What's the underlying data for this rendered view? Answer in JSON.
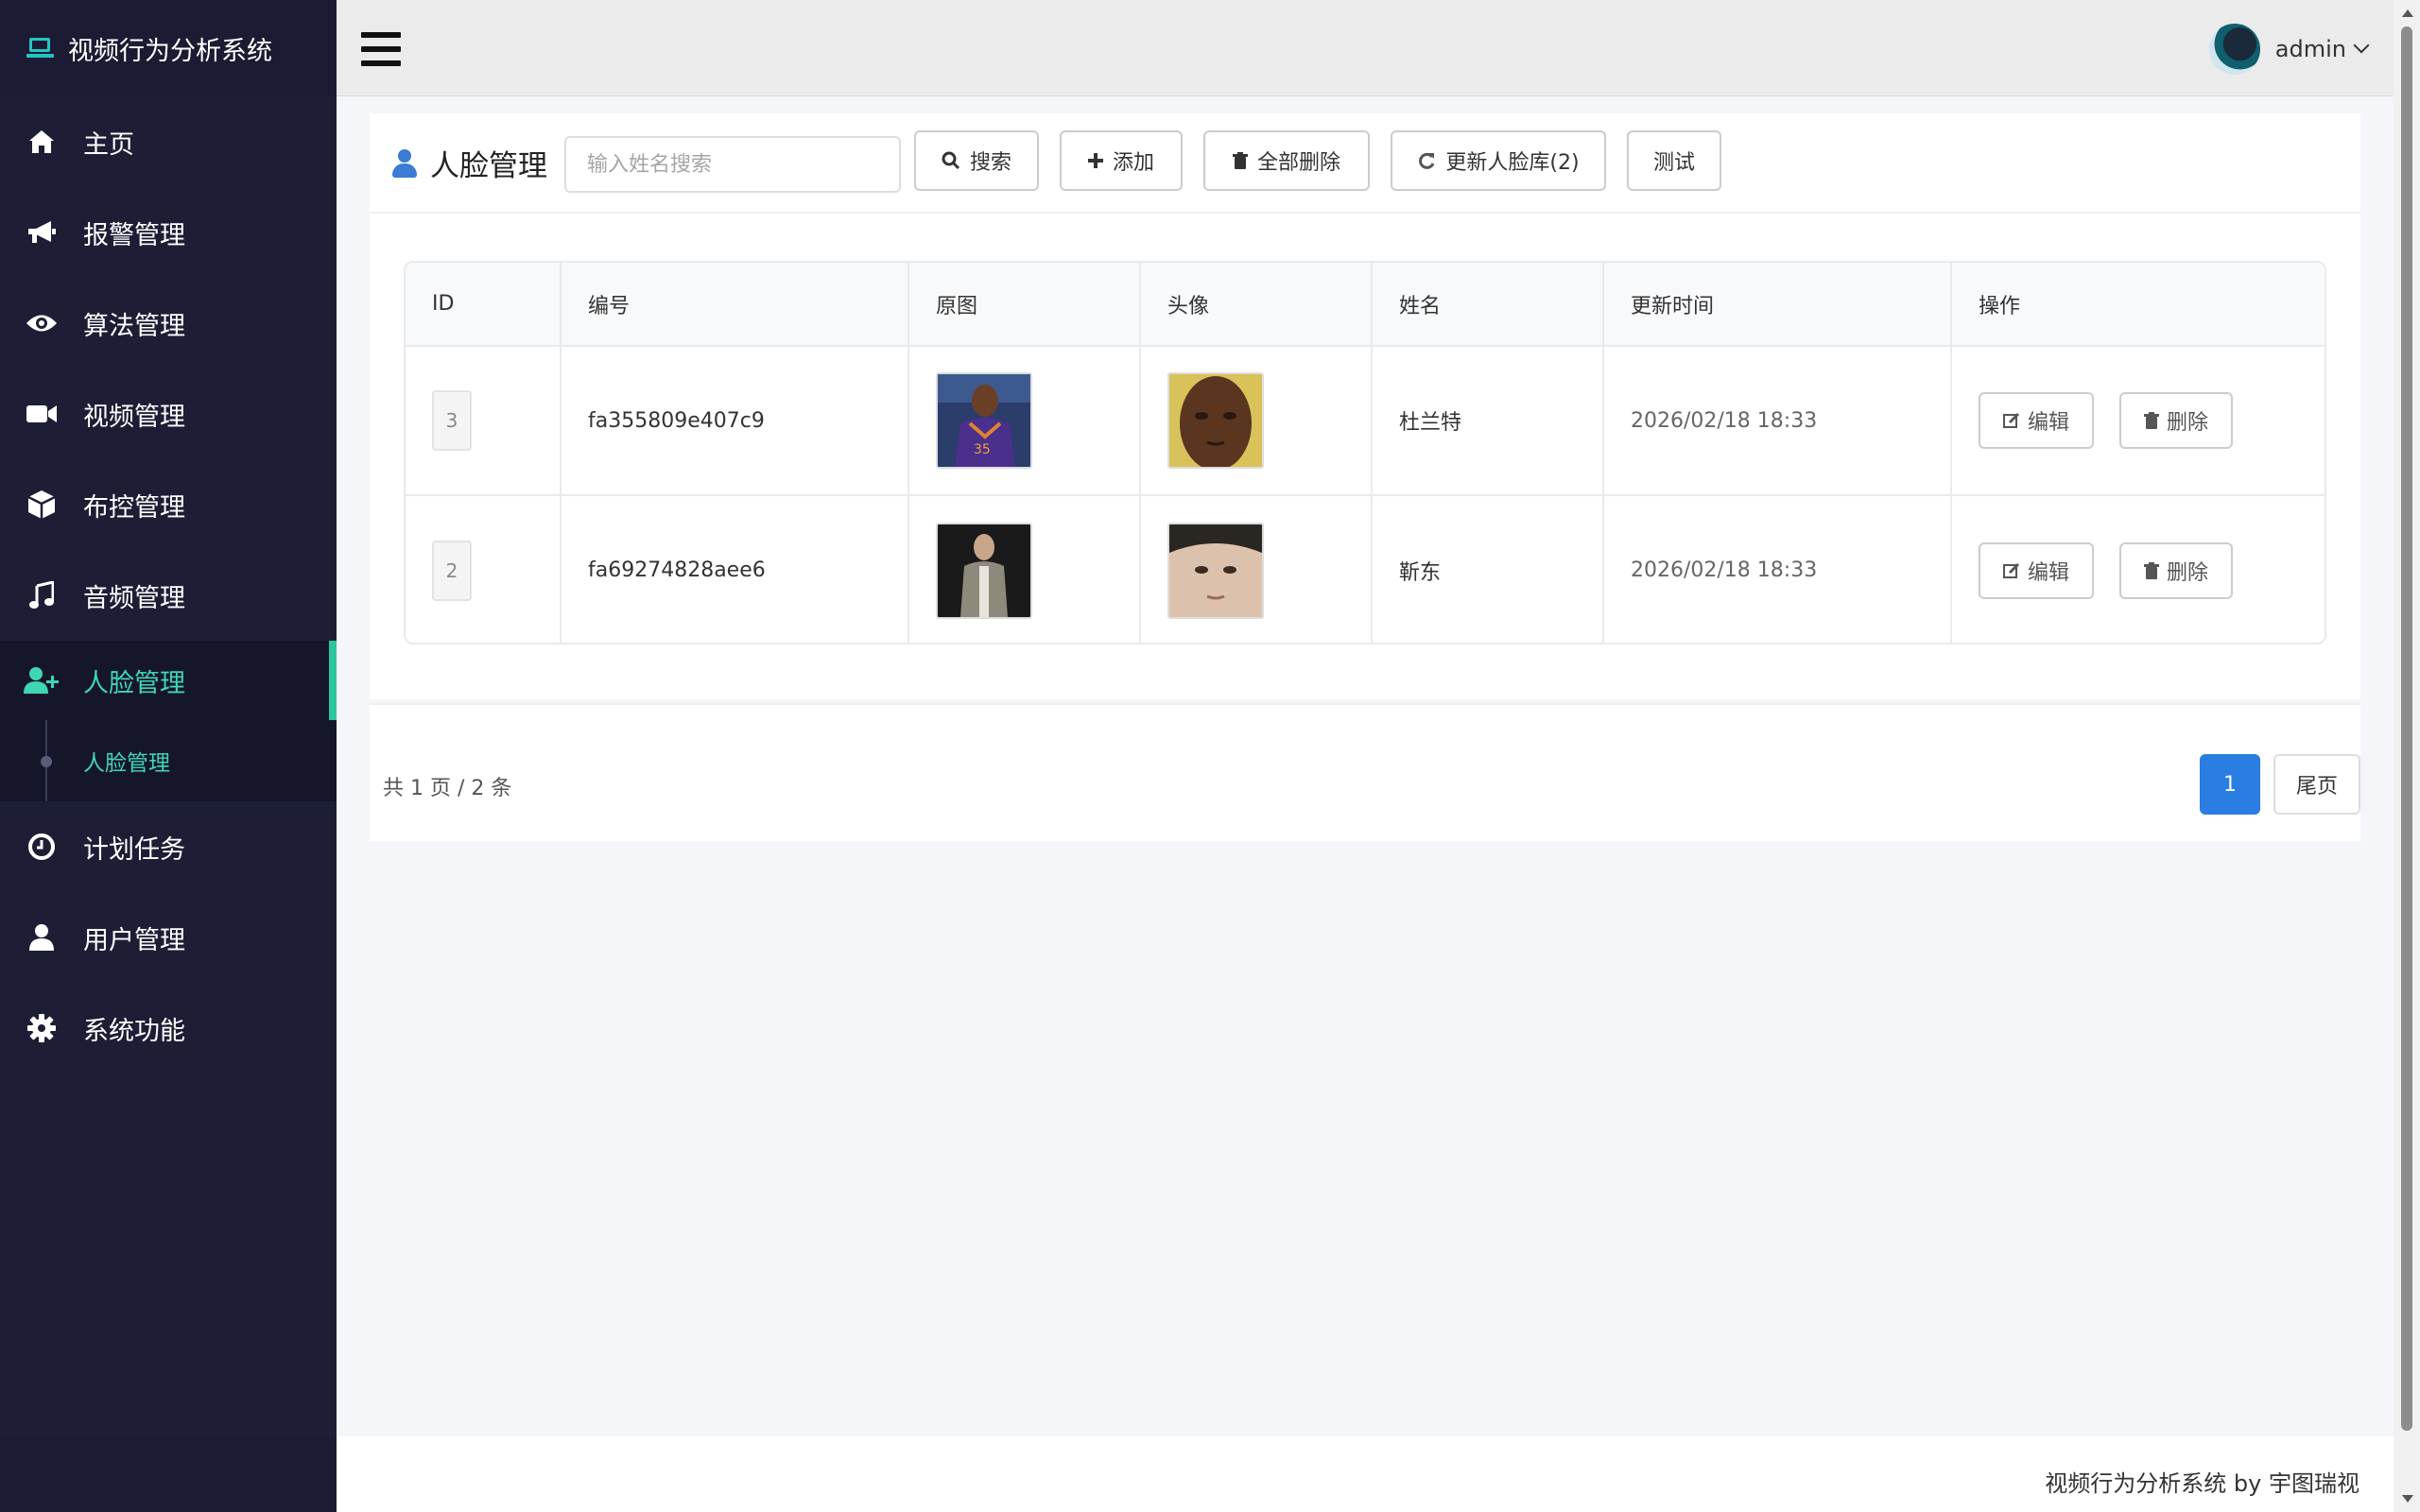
{
  "app": {
    "title": "视频行为分析系统"
  },
  "sidebar": {
    "items": [
      {
        "label": "主页",
        "icon": "home-icon"
      },
      {
        "label": "报警管理",
        "icon": "bullhorn-icon"
      },
      {
        "label": "算法管理",
        "icon": "eye-icon"
      },
      {
        "label": "视频管理",
        "icon": "video-camera-icon"
      },
      {
        "label": "布控管理",
        "icon": "cube-icon"
      },
      {
        "label": "音频管理",
        "icon": "music-icon"
      },
      {
        "label": "人脸管理",
        "icon": "user-plus-icon",
        "active": true
      },
      {
        "label": "计划任务",
        "icon": "clock-icon"
      },
      {
        "label": "用户管理",
        "icon": "user-icon"
      },
      {
        "label": "系统功能",
        "icon": "gear-icon"
      }
    ],
    "sub_item": "人脸管理"
  },
  "header": {
    "user": "admin"
  },
  "page": {
    "title": "人脸管理",
    "search_placeholder": "输入姓名搜索",
    "buttons": {
      "search": "搜索",
      "add": "添加",
      "delete_all": "全部删除",
      "update": "更新人脸库(2)",
      "test": "测试"
    }
  },
  "table": {
    "columns": [
      "ID",
      "编号",
      "原图",
      "头像",
      "姓名",
      "更新时间",
      "操作"
    ],
    "rows": [
      {
        "id": "3",
        "code": "fa355809e407c9",
        "name": "杜兰特",
        "time": "2026/02/18 18:33"
      },
      {
        "id": "2",
        "code": "fa69274828aee6",
        "name": "靳东",
        "time": "2026/02/18 18:33"
      }
    ],
    "actions": {
      "edit": "编辑",
      "delete": "删除"
    }
  },
  "pagination": {
    "info": "共 1 页 / 2 条",
    "current": "1",
    "last": "尾页"
  },
  "footer": {
    "text": "视频行为分析系统 by 宇图瑞视"
  },
  "colors": {
    "sidebar_bg": "#1d1e36",
    "accent": "#3fd6b4",
    "primary": "#2a7de1"
  }
}
